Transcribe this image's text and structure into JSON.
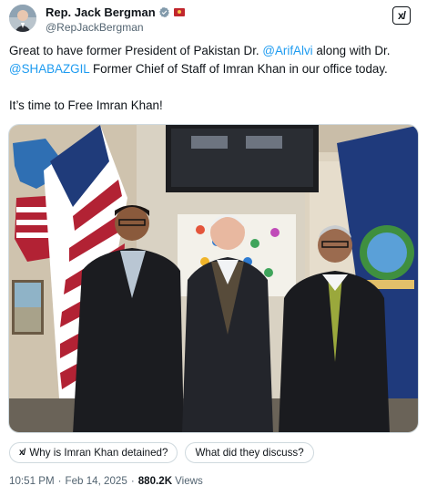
{
  "author": {
    "display_name": "Rep. Jack Bergman",
    "handle": "@RepJackBergman",
    "verified_badge_color": "#829aab",
    "affiliation_flag_color": "#c1272d"
  },
  "header": {
    "grok_label": "x/"
  },
  "tweet": {
    "line1_pre": "Great to have former President of Pakistan Dr. ",
    "mention1": "@ArifAlvi",
    "line1_post": " along with Dr. ",
    "mention2": "@SHABAZGIL",
    "line1_tail": " Former Chief of Staff of Imran Khan in our office today.",
    "line2": "It’s time to Free Imran Khan!",
    "mention_color": "#1d9bf0"
  },
  "suggestions": [
    {
      "icon": "grok-icon",
      "label": "Why is Imran Khan detained?"
    },
    {
      "icon": "",
      "label": "What did they discuss?"
    }
  ],
  "meta": {
    "time": "10:51 PM",
    "date": "Feb 14, 2025",
    "separator": "·",
    "views_count": "880.2K",
    "views_label": "Views"
  }
}
